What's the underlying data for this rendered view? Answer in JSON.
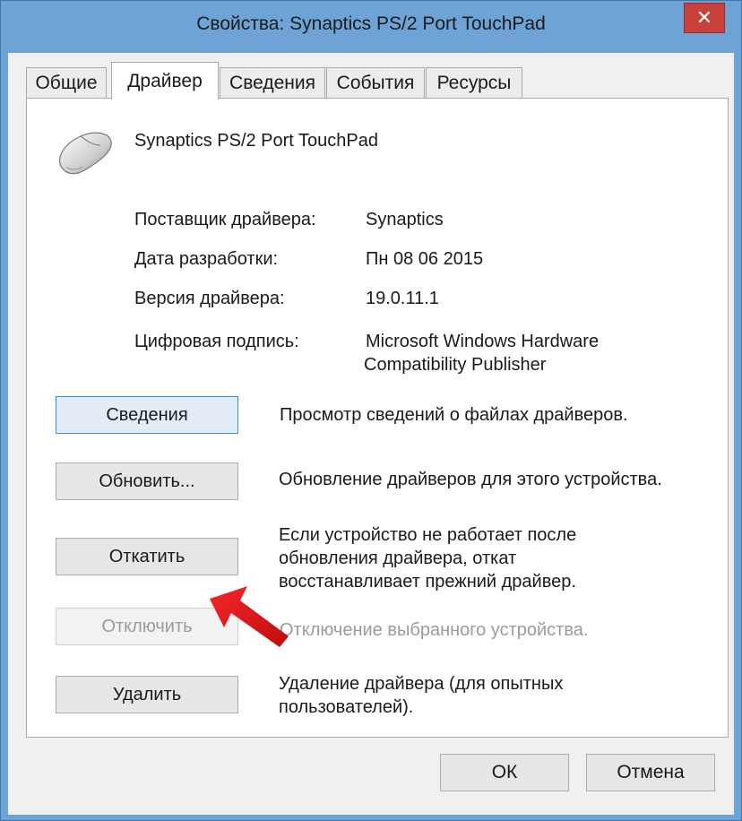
{
  "window": {
    "title": "Свойства: Synaptics PS/2 Port TouchPad",
    "close_glyph": "✕"
  },
  "tabs": [
    {
      "label": "Общие"
    },
    {
      "label": "Драйвер"
    },
    {
      "label": "Сведения"
    },
    {
      "label": "События"
    },
    {
      "label": "Ресурсы"
    }
  ],
  "device": {
    "icon": "mouse-icon",
    "name": "Synaptics PS/2 Port TouchPad"
  },
  "driver_info": {
    "provider_label": "Поставщик драйвера:",
    "provider_value": "Synaptics",
    "date_label": "Дата разработки:",
    "date_value": "Пн 08 06 2015",
    "version_label": "Версия драйвера:",
    "version_value": "19.0.11.1",
    "signature_label": "Цифровая подпись:",
    "signature_line1": "Microsoft Windows Hardware",
    "signature_line2": "Compatibility Publisher"
  },
  "actions": {
    "details_label": "Сведения",
    "details_desc": "Просмотр сведений о файлах драйверов.",
    "update_label": "Обновить...",
    "update_desc": "Обновление драйверов для этого устройства.",
    "rollback_label": "Откатить",
    "rollback_desc_1": "Если устройство не работает после",
    "rollback_desc_2": "обновления драйвера, откат",
    "rollback_desc_3": "восстанавливает прежний драйвер.",
    "disable_label": "Отключить",
    "disable_desc": "Отключение выбранного устройства.",
    "uninstall_label": "Удалить",
    "uninstall_desc_1": "Удаление драйвера (для опытных",
    "uninstall_desc_2": "пользователей)."
  },
  "dialog": {
    "ok_label": "ОК",
    "cancel_label": "Отмена"
  },
  "colors": {
    "window_frame": "#6ea3d5",
    "close_button": "#c7403a",
    "arrow": "#e3151a"
  }
}
